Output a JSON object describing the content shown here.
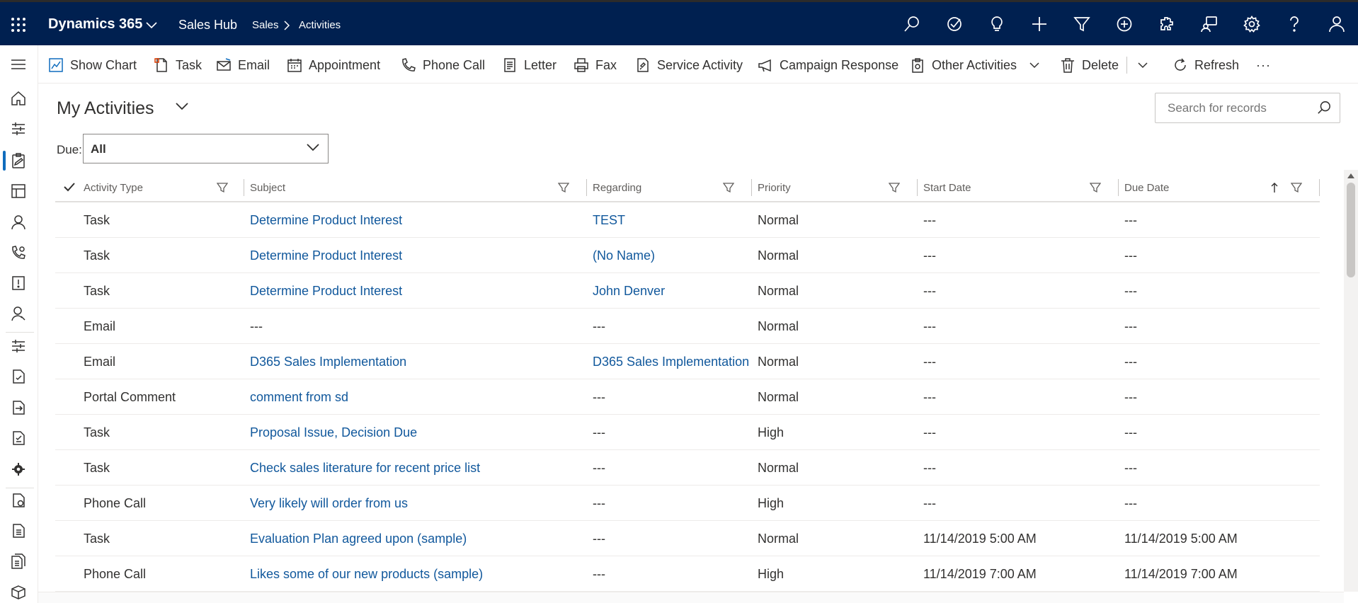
{
  "topbar": {
    "brand": "Dynamics 365",
    "app": "Sales Hub",
    "breadcrumb": [
      "Sales",
      "Activities"
    ],
    "icons": [
      "search-icon",
      "task-check-icon",
      "lightbulb-icon",
      "plus-icon",
      "filter-icon",
      "circle-plus-icon",
      "puzzle-icon",
      "chat-person-icon",
      "gear-icon",
      "help-icon",
      "user-icon"
    ]
  },
  "commandbar": {
    "show_chart": "Show Chart",
    "task": "Task",
    "email": "Email",
    "appointment": "Appointment",
    "phone_call": "Phone Call",
    "letter": "Letter",
    "fax": "Fax",
    "service_activity": "Service Activity",
    "campaign_response": "Campaign Response",
    "other_activities": "Other Activities",
    "delete": "Delete",
    "refresh": "Refresh",
    "more": "···"
  },
  "view": {
    "title": "My Activities",
    "search_placeholder": "Search for records",
    "due_label": "Due:",
    "due_value": "All"
  },
  "grid": {
    "columns": [
      "Activity Type",
      "Subject",
      "Regarding",
      "Priority",
      "Start Date",
      "Due Date"
    ],
    "sort_column": "Due Date",
    "sort_direction": "ascending",
    "rows": [
      {
        "type": "Task",
        "subject": "Determine Product Interest",
        "regarding": "TEST",
        "priority": "Normal",
        "start": "---",
        "due": "---"
      },
      {
        "type": "Task",
        "subject": "Determine Product Interest",
        "regarding": "(No Name)",
        "priority": "Normal",
        "start": "---",
        "due": "---"
      },
      {
        "type": "Task",
        "subject": "Determine Product Interest",
        "regarding": "John Denver",
        "priority": "Normal",
        "start": "---",
        "due": "---"
      },
      {
        "type": "Email",
        "subject": "---",
        "regarding": "---",
        "priority": "Normal",
        "start": "---",
        "due": "---"
      },
      {
        "type": "Email",
        "subject": "D365 Sales Implementation",
        "regarding": "D365 Sales Implementation",
        "priority": "Normal",
        "start": "---",
        "due": "---"
      },
      {
        "type": "Portal Comment",
        "subject": "comment from sd",
        "regarding": "---",
        "priority": "Normal",
        "start": "---",
        "due": "---"
      },
      {
        "type": "Task",
        "subject": "Proposal Issue, Decision Due",
        "regarding": "---",
        "priority": "High",
        "start": "---",
        "due": "---"
      },
      {
        "type": "Task",
        "subject": "Check sales literature for recent price list",
        "regarding": "---",
        "priority": "Normal",
        "start": "---",
        "due": "---"
      },
      {
        "type": "Phone Call",
        "subject": "Very likely will order from us",
        "regarding": "---",
        "priority": "High",
        "start": "---",
        "due": "---"
      },
      {
        "type": "Task",
        "subject": "Evaluation Plan agreed upon (sample)",
        "regarding": "---",
        "priority": "Normal",
        "start": "11/14/2019 5:00 AM",
        "due": "11/14/2019 5:00 AM"
      },
      {
        "type": "Phone Call",
        "subject": "Likes some of our new products (sample)",
        "regarding": "---",
        "priority": "High",
        "start": "11/14/2019 7:00 AM",
        "due": "11/14/2019 7:00 AM"
      }
    ]
  },
  "colors": {
    "topbar_bg": "#002050",
    "link": "#11589c",
    "accent": "#0f6cbd"
  }
}
